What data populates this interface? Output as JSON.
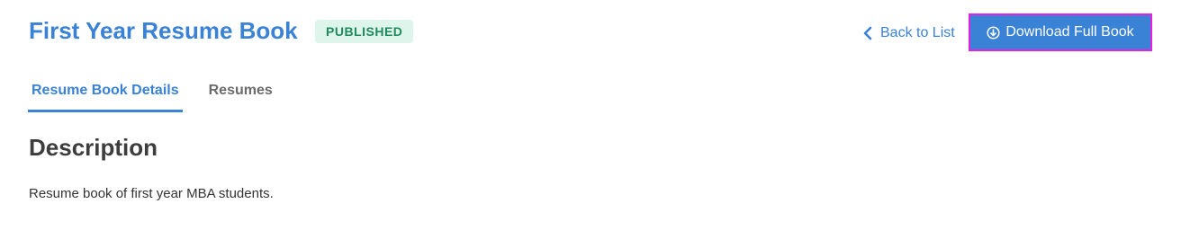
{
  "header": {
    "title": "First Year Resume Book",
    "status_badge": "PUBLISHED",
    "back_link_label": "Back to List",
    "back_link_icon": "chevron-left-icon",
    "download_button_label": "Download Full Book",
    "download_button_icon": "download-circle-icon"
  },
  "tabs": [
    {
      "label": "Resume Book Details",
      "active": true
    },
    {
      "label": "Resumes",
      "active": false
    }
  ],
  "main": {
    "section_heading": "Description",
    "description": "Resume book of first year MBA students."
  },
  "colors": {
    "accent": "#3a82d6",
    "badge_bg": "#def5ec",
    "badge_text": "#1f8a5b",
    "focus_outline": "#e81ee0"
  }
}
